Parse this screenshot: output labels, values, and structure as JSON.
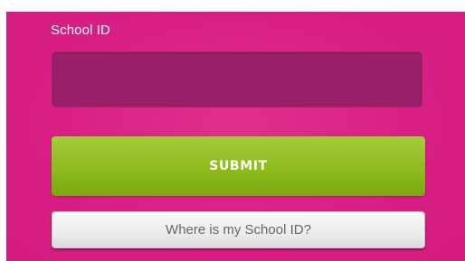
{
  "form": {
    "school_id_label": "School ID",
    "school_id_value": "",
    "submit_label": "SUBMIT",
    "help_label": "Where is my School ID?"
  },
  "colors": {
    "background": "#d91f85",
    "input_fill": "#9b1f68",
    "submit": "#8fbb1d",
    "help_button": "#ececec"
  }
}
